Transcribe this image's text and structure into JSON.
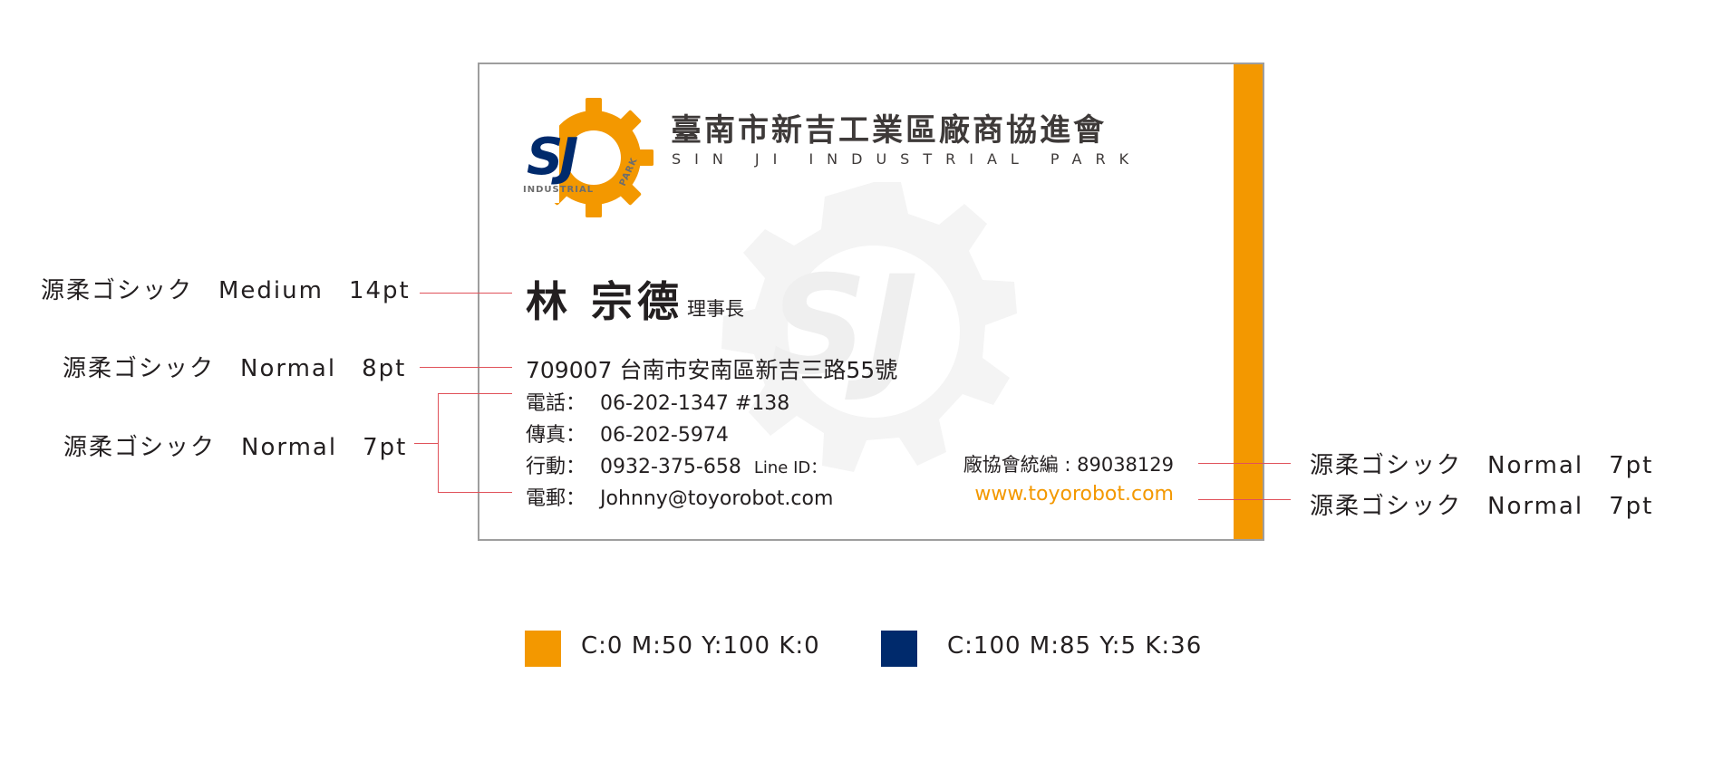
{
  "card": {
    "org_name_zh": "臺南市新吉工業區廠商協進會",
    "org_name_en": "SIN JI INDUSTRIAL PARK",
    "logo": {
      "initials": "SJ",
      "ring_text_bottom": "INDUSTRIAL",
      "ring_text_side": "PARK"
    },
    "person_name": "林 宗德",
    "person_title": "理事長",
    "address": "709007 台南市安南區新吉三路55號",
    "contacts": [
      {
        "label": "電話：",
        "value": "06-202-1347 #138",
        "extra": ""
      },
      {
        "label": "傳真：",
        "value": "06-202-5974",
        "extra": ""
      },
      {
        "label": "行動：",
        "value": "0932-375-658",
        "extra": "Line ID："
      },
      {
        "label": "電郵：",
        "value": "Johnny@toyorobot.com",
        "extra": ""
      }
    ],
    "tax_id": "廠協會統編 : 89038129",
    "website": "www.toyorobot.com"
  },
  "annotations": {
    "name_font": "源柔ゴシック　Medium　14pt",
    "address_font": "源柔ゴシック　Normal　8pt",
    "contacts_font": "源柔ゴシック　Normal　7pt",
    "tax_font": "源柔ゴシック　Normal　7pt",
    "website_font": "源柔ゴシック　Normal　7pt"
  },
  "swatches": [
    {
      "color": "#f39800",
      "label": "C:0 M:50 Y:100 K:0"
    },
    {
      "color": "#002a6c",
      "label": "C:100 M:85 Y:5 K:36"
    }
  ],
  "colors": {
    "accent_orange": "#f39800",
    "brand_navy": "#002a6c",
    "leader_red": "#e0525a"
  }
}
